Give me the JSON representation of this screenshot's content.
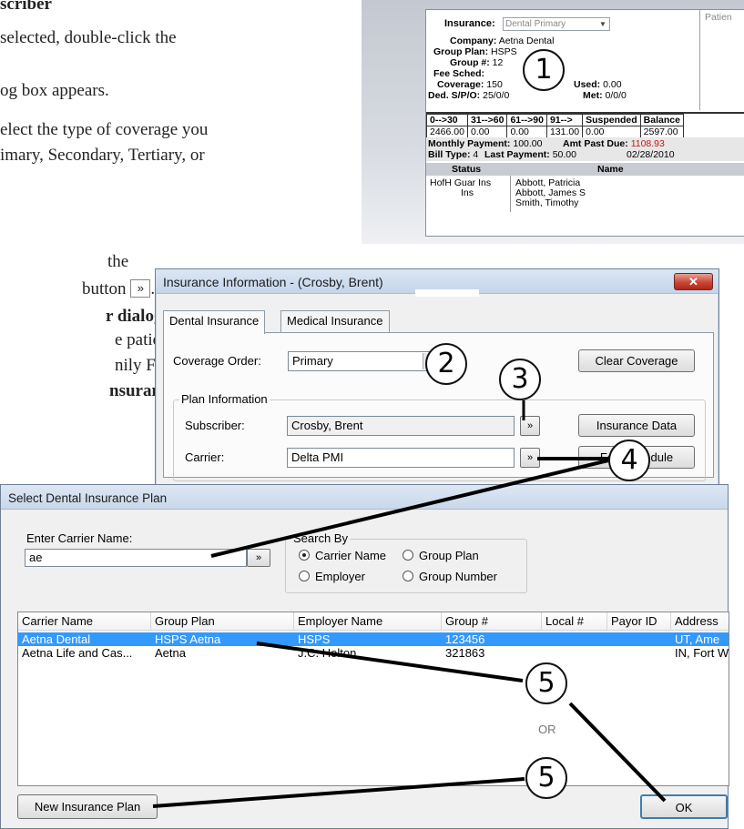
{
  "doc": {
    "lines": [
      "scriber",
      "selected, double-click the",
      "og box appears.",
      "elect the type of coverage you",
      "imary, Secondary, Tertiary, or",
      "the",
      "button",
      "r dialog box,",
      "e patient",
      "nily File",
      "nsurance"
    ],
    "button_glyph": "»"
  },
  "family_file": {
    "insurance_label": "Insurance:",
    "insurance_value": "Dental Primary",
    "patient_label": "Patien",
    "company_label": "Company:",
    "company_value": "Aetna Dental",
    "group_plan_label": "Group Plan:",
    "group_plan_value": "HSPS",
    "group_num_label": "Group #:",
    "group_num_value": "12",
    "fee_sched_label": "Fee Sched:",
    "coverage_label": "Coverage:",
    "coverage_value": "150",
    "used_label": "Used:",
    "used_value": "0.00",
    "ded_label": "Ded. S/P/O:",
    "ded_value": "25/0/0",
    "met_label": "Met:",
    "met_value": "0/0/0",
    "aging_headers": [
      "0-->30",
      "31-->60",
      "61-->90",
      "91-->",
      "Suspended",
      "Balance"
    ],
    "aging_values": [
      "2466.00",
      "0.00",
      "0.00",
      "131.00",
      "0.00",
      "2597.00"
    ],
    "monthly_payment_label": "Monthly Payment:",
    "monthly_payment_value": "100.00",
    "amt_past_due_label": "Amt Past Due:",
    "amt_past_due_value": "1108.93",
    "bill_type_label": "Bill Type:",
    "bill_type_value": "4",
    "last_payment_label": "Last Payment:",
    "last_payment_value": "50.00",
    "last_payment_date": "02/28/2010",
    "status_header": "Status",
    "name_header": "Name",
    "status_values": [
      "HofH Guar Ins",
      "Ins"
    ],
    "names": [
      "Abbott, Patricia",
      "Abbott, James S",
      "Smith, Timothy"
    ]
  },
  "insurance_dialog": {
    "title": "Insurance Information - (Crosby, Brent)",
    "close_glyph": "✕",
    "tabs": [
      "Dental Insurance",
      "Medical Insurance"
    ],
    "coverage_order_label": "Coverage Order:",
    "coverage_order_value": "Primary",
    "clear_coverage_label": "Clear Coverage",
    "plan_info_label": "Plan Information",
    "subscriber_label": "Subscriber:",
    "subscriber_value": "Crosby, Brent",
    "carrier_label": "Carrier:",
    "carrier_value": "Delta PMI",
    "insurance_data_label": "Insurance Data",
    "fee_schedule_label": "Fee Schedule",
    "browse_glyph": "»"
  },
  "select_plan_dialog": {
    "title": "Select Dental Insurance Plan",
    "enter_carrier_label": "Enter Carrier Name:",
    "carrier_search_value": "ae",
    "search_by_label": "Search By",
    "radio_options": [
      "Carrier Name",
      "Group Plan",
      "Employer",
      "Group Number"
    ],
    "selected_option": "Carrier Name",
    "columns": [
      "Carrier Name",
      "Group Plan",
      "Employer Name",
      "Group #",
      "Local #",
      "Payor ID",
      "Address"
    ],
    "rows": [
      [
        "Aetna Dental",
        "HSPS Aetna",
        "HSPS",
        "123456",
        "",
        "",
        "UT, Ame"
      ],
      [
        "Aetna Life and Cas...",
        "Aetna",
        "J.C. Holton",
        "321863",
        "",
        "",
        "IN, Fort W"
      ]
    ],
    "new_plan_label": "New Insurance Plan",
    "ok_label": "OK",
    "or_text": "OR"
  },
  "callouts": [
    "1",
    "2",
    "3",
    "4",
    "5",
    "5"
  ]
}
